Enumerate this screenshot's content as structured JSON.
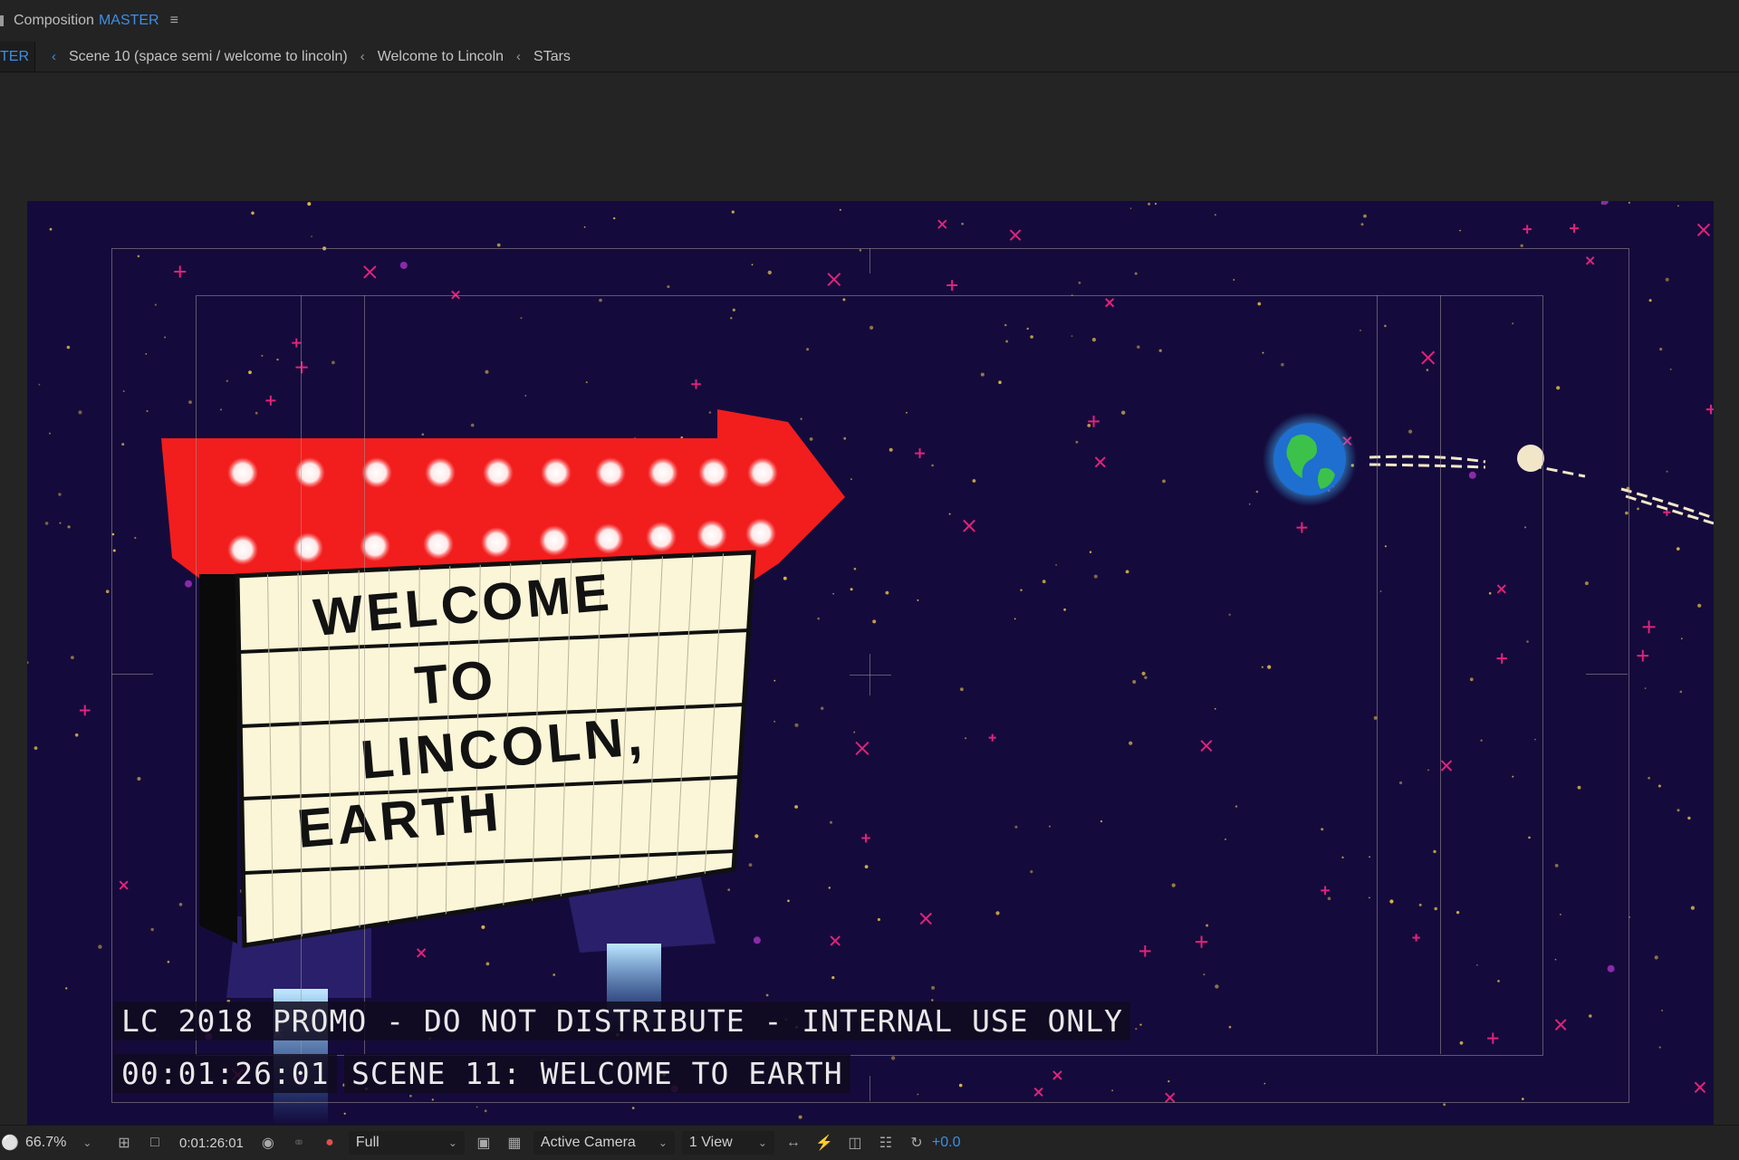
{
  "panel": {
    "title": "Composition",
    "comp_name": "MASTER",
    "menu_icon": "hamburger-menu-icon"
  },
  "breadcrumbs": {
    "active": "TER",
    "items": [
      "Scene 10 (space semi / welcome to lincoln)",
      "Welcome to Lincoln",
      "STars"
    ]
  },
  "composition": {
    "sign_lines": [
      "WELCOME",
      "TO",
      "LINCOLN,",
      "EARTH"
    ],
    "overlay_line1": "LC 2018 PROMO - DO NOT DISTRIBUTE - INTERNAL USE ONLY",
    "timecode": "00:01:26:01",
    "scene_label": "SCENE 11: WELCOME TO EARTH",
    "colors": {
      "background": "#140b3c",
      "sign_arrow": "#f21d1d",
      "sign_board": "#fbf6d8",
      "star_yellow": "#d9b54a",
      "star_pink": "#e0237a"
    }
  },
  "toolbar": {
    "zoom": "66.7%",
    "current_time": "0:01:26:01",
    "resolution": "Full",
    "camera": "Active Camera",
    "view_layout": "1 View",
    "exposure": "+0.0"
  }
}
